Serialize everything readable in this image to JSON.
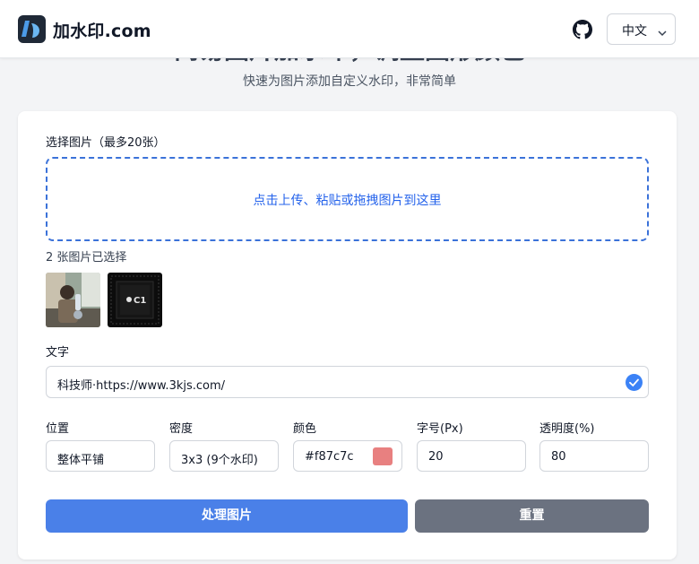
{
  "header": {
    "brand": "加水印.com",
    "language": "中文"
  },
  "hero": {
    "title": "简易图片加水印，调整图形颜色",
    "subtitle": "快速为图片添加自定义水印，非常简单"
  },
  "upload": {
    "label": "选择图片（最多20张）",
    "dropzone_text": "点击上传、粘贴或拖拽图片到这里",
    "selected_count_text": "2 张图片已选择",
    "thumbnails": [
      "photo-thumbnail-person",
      "photo-thumbnail-chip-c1"
    ],
    "chip_text": "C1"
  },
  "watermark_text": {
    "label": "文字",
    "value": "科技师·https://www.3kjs.com/"
  },
  "settings": {
    "position": {
      "label": "位置",
      "value": "整体平铺"
    },
    "density": {
      "label": "密度",
      "value": "3x3 (9个水印)"
    },
    "color": {
      "label": "颜色",
      "value": "#f87c7c",
      "swatch": "#e88080"
    },
    "font_size": {
      "label": "字号(Px)",
      "value": "20"
    },
    "opacity": {
      "label": "透明度(%)",
      "value": "80"
    }
  },
  "actions": {
    "process_label": "处理图片",
    "reset_label": "重置"
  },
  "colors": {
    "primary": "#4a80e8",
    "secondary": "#6b7280",
    "accent_blue": "#2563eb"
  }
}
